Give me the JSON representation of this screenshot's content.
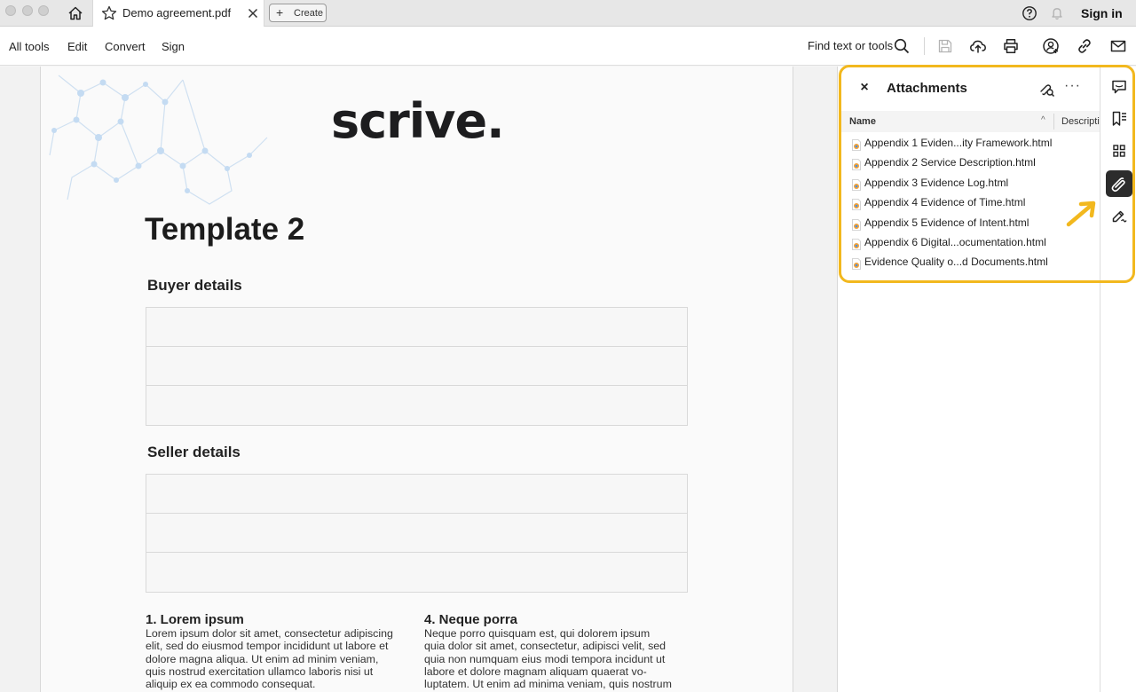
{
  "titlebar": {
    "tab_title": "Demo agreement.pdf",
    "create_label": "Create",
    "sign_in": "Sign in"
  },
  "menubar": {
    "items": [
      "All tools",
      "Edit",
      "Convert",
      "Sign"
    ],
    "find_label": "Find text or tools"
  },
  "document": {
    "logo": "scrive.",
    "title": "Template 2",
    "buyer_heading": "Buyer details",
    "seller_heading": "Seller details",
    "clauses": [
      {
        "heading": "1. Lorem ipsum",
        "lines": [
          "Lorem ipsum dolor sit amet, consectetur adipiscing",
          "elit, sed do eiusmod tempor incididunt ut labore et",
          "dolore magna aliqua. Ut enim ad minim veniam,",
          "quis nostrud exercitation ullamco laboris nisi ut",
          "aliquip ex ea commodo consequat."
        ]
      },
      {
        "heading": "4. Neque porra",
        "lines": [
          "Neque porro quisquam est, qui dolorem ipsum",
          "quia dolor sit amet, consectetur, adipisci velit, sed",
          "quia non numquam eius modi tempora incidunt ut",
          "labore et dolore magnam aliquam quaerat vo-",
          "luptatem. Ut enim ad minima veniam, quis nostrum"
        ]
      }
    ]
  },
  "attachments": {
    "title": "Attachments",
    "col_name": "Name",
    "col_description": "Description",
    "items": [
      "Appendix 1 Eviden...ity Framework.html",
      "Appendix 2 Service Description.html",
      "Appendix 3 Evidence Log.html",
      "Appendix 4 Evidence of Time.html",
      "Appendix 5 Evidence of Intent.html",
      "Appendix 6 Digital...ocumentation.html",
      "Evidence Quality o...d Documents.html"
    ]
  },
  "colors": {
    "highlight": "#f2b81e",
    "active_rail": "#2c2c2c"
  }
}
